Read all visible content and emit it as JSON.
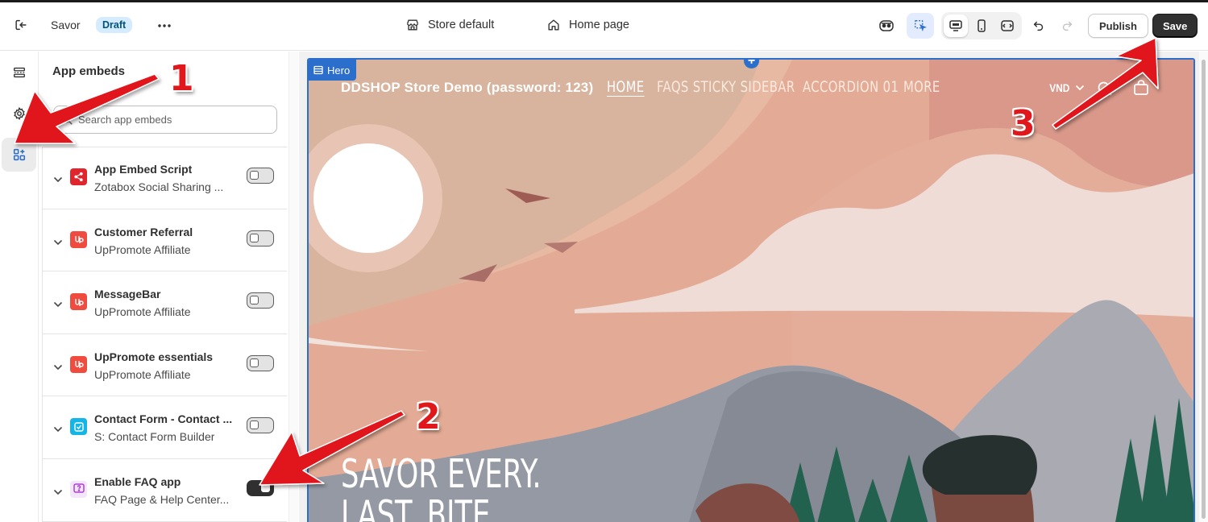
{
  "topbar": {
    "theme_name": "Savor",
    "status_badge": "Draft",
    "store_label": "Store default",
    "page_label": "Home page",
    "publish_label": "Publish",
    "save_label": "Save"
  },
  "panel": {
    "title": "App embeds",
    "search_placeholder": "Search app embeds",
    "embeds": [
      {
        "name": "App Embed Script",
        "provider": "Zotabox Social Sharing ...",
        "enabled": false,
        "icon": "share-icon",
        "color": "#e0262c"
      },
      {
        "name": "Customer Referral",
        "provider": "UpPromote Affiliate",
        "enabled": false,
        "icon": "uppromote-icon",
        "color": "#ef4c3f"
      },
      {
        "name": "MessageBar",
        "provider": "UpPromote Affiliate",
        "enabled": false,
        "icon": "uppromote-icon",
        "color": "#ef4c3f"
      },
      {
        "name": "UpPromote essentials",
        "provider": "UpPromote Affiliate",
        "enabled": false,
        "icon": "uppromote-icon",
        "color": "#ef4c3f"
      },
      {
        "name": "Contact Form - Contact ...",
        "provider": "S: Contact Form Builder",
        "enabled": false,
        "icon": "contact-form-icon",
        "color": "#16b5e8"
      },
      {
        "name": "Enable FAQ app",
        "provider": "FAQ Page & Help Center...",
        "enabled": true,
        "icon": "faq-icon",
        "color": "#c06ae0"
      }
    ]
  },
  "preview": {
    "section_tag": "Hero",
    "store_name": "DDSHOP Store Demo (password: 123)",
    "nav_items": [
      "HOME",
      "FAQS STICKY SIDEBAR",
      "ACCORDION 01",
      "MORE"
    ],
    "currency": "VND",
    "heading_line1": "SAVOR EVERY.",
    "heading_line2": "LAST. BITE"
  },
  "annotations": {
    "step1": "1",
    "step2": "2",
    "step3": "3",
    "arrow_color": "#e0181b"
  }
}
